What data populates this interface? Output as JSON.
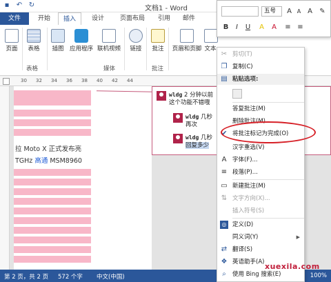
{
  "window": {
    "title": "文档1 - Word"
  },
  "qat": [
    "save",
    "undo",
    "redo"
  ],
  "menu": {
    "file": "文件",
    "tabs": [
      "开始",
      "插入",
      "设计",
      "页面布局",
      "引用",
      "邮件"
    ],
    "active_index": 1
  },
  "ribbon": {
    "buttons": [
      {
        "label": "页面",
        "icon": "page-icon"
      },
      {
        "label": "表格",
        "icon": "table-icon"
      },
      {
        "label": "插图",
        "icon": "illustration-icon"
      },
      {
        "label": "应用程序",
        "icon": "app-icon"
      },
      {
        "label": "联机视频",
        "icon": "video-icon"
      },
      {
        "label": "链接",
        "icon": "link-icon"
      },
      {
        "label": "批注",
        "icon": "comment-icon"
      },
      {
        "label": "页眉和页脚",
        "icon": "header-footer-icon"
      },
      {
        "label": "文本",
        "icon": "text-icon"
      }
    ],
    "groups": [
      "表格",
      "媒体",
      "批注"
    ]
  },
  "ruler": {
    "numbers": [
      "30",
      "32",
      "34",
      "36",
      "38",
      "40",
      "42",
      "44"
    ]
  },
  "document": {
    "line1": "拉 Moto X 正式发布亮",
    "line2_prefix": "TGHz ",
    "line2_link": "高通",
    "line2_suffix": " MSM8960"
  },
  "comments": [
    {
      "author": "wldg",
      "text": "2 分钟以前",
      "reply": "这个功能不错哦"
    },
    {
      "author": "wldg",
      "text": "几秒",
      "reply": "再次"
    },
    {
      "author": "wldg",
      "text": "几秒",
      "reply": "回复多少"
    }
  ],
  "minibar": {
    "font": "",
    "size": "五号",
    "buttons": [
      "B",
      "I",
      "U",
      "A",
      "A",
      "≡",
      "≡"
    ]
  },
  "context_menu": {
    "items": [
      {
        "label": "剪切(T)",
        "icon": "scissors-icon",
        "disabled": true
      },
      {
        "label": "复制(C)",
        "icon": "copy-icon",
        "disabled": false
      },
      {
        "label": "粘贴选项:",
        "icon": "paste-icon",
        "disabled": false,
        "header": true
      },
      {
        "label": "答复批注(M)",
        "icon": "reply-icon",
        "disabled": false
      },
      {
        "label": "删除批注(M)",
        "icon": "delete-comment-icon",
        "disabled": false
      },
      {
        "label": "将批注标记为完成(O)",
        "icon": "checkmark-icon",
        "disabled": false
      },
      {
        "label": "汉字重选(V)",
        "icon": "",
        "disabled": false
      },
      {
        "label": "字体(F)...",
        "icon": "font-icon",
        "disabled": false
      },
      {
        "label": "段落(P)...",
        "icon": "paragraph-icon",
        "disabled": false
      },
      {
        "label": "新建批注(M)",
        "icon": "new-comment-icon",
        "disabled": false
      },
      {
        "label": "文字方向(X)...",
        "icon": "text-direction-icon",
        "disabled": true
      },
      {
        "label": "插入符号(S)",
        "icon": "",
        "disabled": true
      },
      {
        "label": "定义(D)",
        "icon": "define-icon",
        "disabled": false
      },
      {
        "label": "同义词(Y)",
        "icon": "",
        "disabled": false,
        "submenu": true
      },
      {
        "label": "翻译(S)",
        "icon": "translate-icon",
        "disabled": false
      },
      {
        "label": "英语助手(A)",
        "icon": "english-assistant-icon",
        "disabled": false
      },
      {
        "label": "使用 Bing 搜索(E)",
        "icon": "search-icon",
        "disabled": false
      }
    ]
  },
  "statusbar": {
    "page": "第 2 页，共 2 页",
    "words": "572 个字",
    "lang": "中文(中国)",
    "zoom": "100%"
  },
  "watermark": "xuexila.com",
  "colors": {
    "accent": "#2b579a",
    "highlight": "#d61f26",
    "comment": "#b0234a"
  }
}
